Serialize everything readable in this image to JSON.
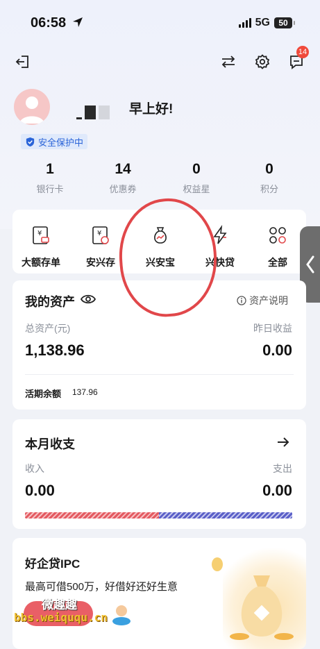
{
  "status_bar": {
    "time": "06:58",
    "network": "5G",
    "battery": "50"
  },
  "header": {
    "notifications_count": "14"
  },
  "profile": {
    "greeting": "早上好!",
    "protection_label": "安全保护中"
  },
  "stats": [
    {
      "value": "1",
      "label": "银行卡"
    },
    {
      "value": "14",
      "label": "优惠券"
    },
    {
      "value": "0",
      "label": "权益星"
    },
    {
      "value": "0",
      "label": "积分"
    }
  ],
  "quick_actions": [
    {
      "label": "大额存单",
      "icon": "deposit-certificate-icon"
    },
    {
      "label": "安兴存",
      "icon": "savings-icon"
    },
    {
      "label": "兴安宝",
      "icon": "money-bag-icon"
    },
    {
      "label": "兴快贷",
      "icon": "lightning-icon"
    },
    {
      "label": "全部",
      "icon": "grid-icon"
    }
  ],
  "assets": {
    "title": "我的资产",
    "help_label": "资产说明",
    "total_label": "总资产(元)",
    "total_value": "1,138.96",
    "yesterday_label": "昨日收益",
    "yesterday_value": "0.00",
    "current_label": "活期余额",
    "current_value": "137.96"
  },
  "monthly": {
    "title": "本月收支",
    "income_label": "收入",
    "income_value": "0.00",
    "expense_label": "支出",
    "expense_value": "0.00",
    "income_share": 0.5
  },
  "promo": {
    "title": "好企贷IPC",
    "subtitle": "最高可借500万，好借好还好生意"
  },
  "watermark": {
    "cn": "微趣趣",
    "url": "bbs.weiququ.cn"
  },
  "colors": {
    "accent_red": "#e1474a",
    "badge": "#f04a3b",
    "protect_blue": "#2a64d8"
  }
}
